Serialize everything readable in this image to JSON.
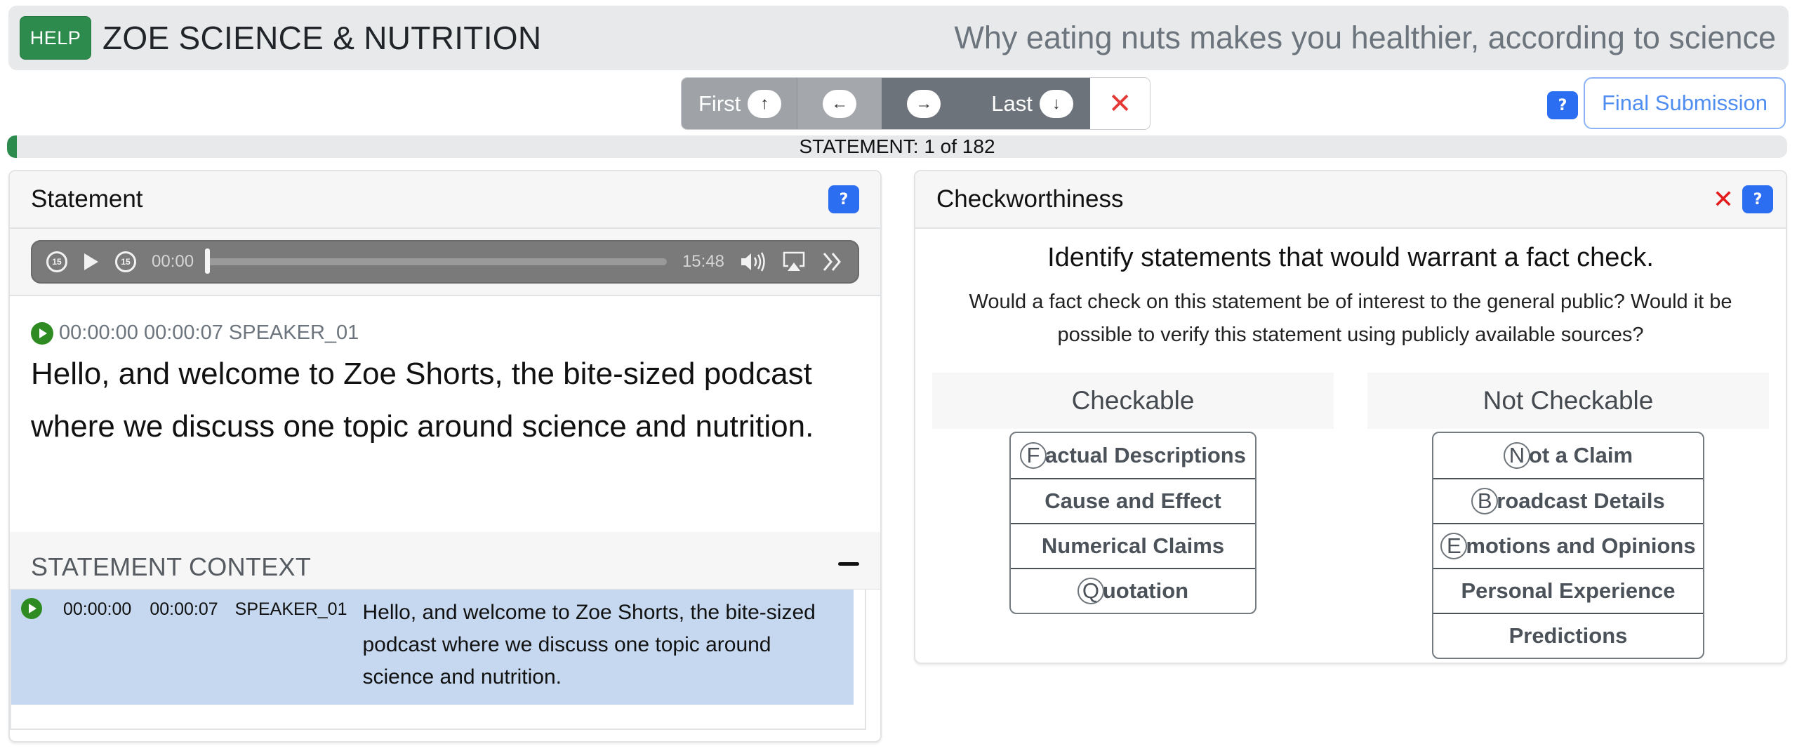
{
  "header": {
    "help_label": "HELP",
    "brand": "ZOE SCIENCE & NUTRITION",
    "episode_title": "Why eating nuts makes you healthier, according to science"
  },
  "nav": {
    "first_label": "First",
    "first_icon": "↑",
    "prev_icon": "←",
    "next_icon": "→",
    "last_label": "Last",
    "last_icon": "↓",
    "close_icon": "✕"
  },
  "toolbar": {
    "help_icon": "?",
    "final_submission_label": "Final Submission"
  },
  "progress": {
    "label": "STATEMENT: 1 of 182",
    "current": 1,
    "total": 182
  },
  "statement_panel": {
    "title": "Statement",
    "help_icon": "?",
    "player": {
      "skip_back_label": "15",
      "skip_forward_label": "15",
      "current_time": "00:00",
      "duration": "15:48",
      "position_fraction": 0
    },
    "statement": {
      "start": "00:00:00",
      "end": "00:00:07",
      "speaker": "SPEAKER_01",
      "meta": "00:00:00 00:00:07 SPEAKER_01",
      "text": "Hello, and welcome to Zoe Shorts, the bite-sized podcast where we discuss one topic around science and nutrition."
    },
    "context": {
      "title": "STATEMENT CONTEXT",
      "collapse_icon": "−",
      "rows": [
        {
          "start": "00:00:00",
          "end": "00:00:07",
          "speaker": "SPEAKER_01",
          "text": "Hello, and welcome to Zoe Shorts, the bite-sized podcast where we discuss one topic around science and nutrition."
        }
      ]
    }
  },
  "checkworthiness_panel": {
    "title": "Checkworthiness",
    "clear_icon": "✕",
    "help_icon": "?",
    "instruction": "Identify statements that would warrant a fact check.",
    "sub_instruction": "Would a fact check on this statement be of interest to the general public? Would it be possible to verify this statement using publicly available sources?",
    "checkable": {
      "heading": "Checkable",
      "options": [
        {
          "key": "F",
          "rest": "actual Descriptions",
          "label": "Factual Descriptions"
        },
        {
          "key": "",
          "rest": "Cause and Effect",
          "label": "Cause and Effect"
        },
        {
          "key": "",
          "rest": "Numerical Claims",
          "label": "Numerical Claims"
        },
        {
          "key": "Q",
          "rest": "uotation",
          "label": "Quotation"
        }
      ]
    },
    "not_checkable": {
      "heading": "Not Checkable",
      "options": [
        {
          "key": "N",
          "rest": "ot a Claim",
          "label": "Not a Claim"
        },
        {
          "key": "B",
          "rest": "roadcast Details",
          "label": "Broadcast Details"
        },
        {
          "key": "E",
          "rest": "motions and Opinions",
          "label": "Emotions and Opinions"
        },
        {
          "key": "",
          "rest": "Personal Experience",
          "label": "Personal Experience"
        },
        {
          "key": "",
          "rest": "Predictions",
          "label": "Predictions"
        }
      ]
    }
  },
  "colors": {
    "help_green": "#2e8b4e",
    "accent_blue": "#2c6ef2",
    "outline_blue": "#4f8ef0",
    "danger_red": "#e53935",
    "context_highlight": "#c5d8ef",
    "play_green": "#2e8b22"
  }
}
